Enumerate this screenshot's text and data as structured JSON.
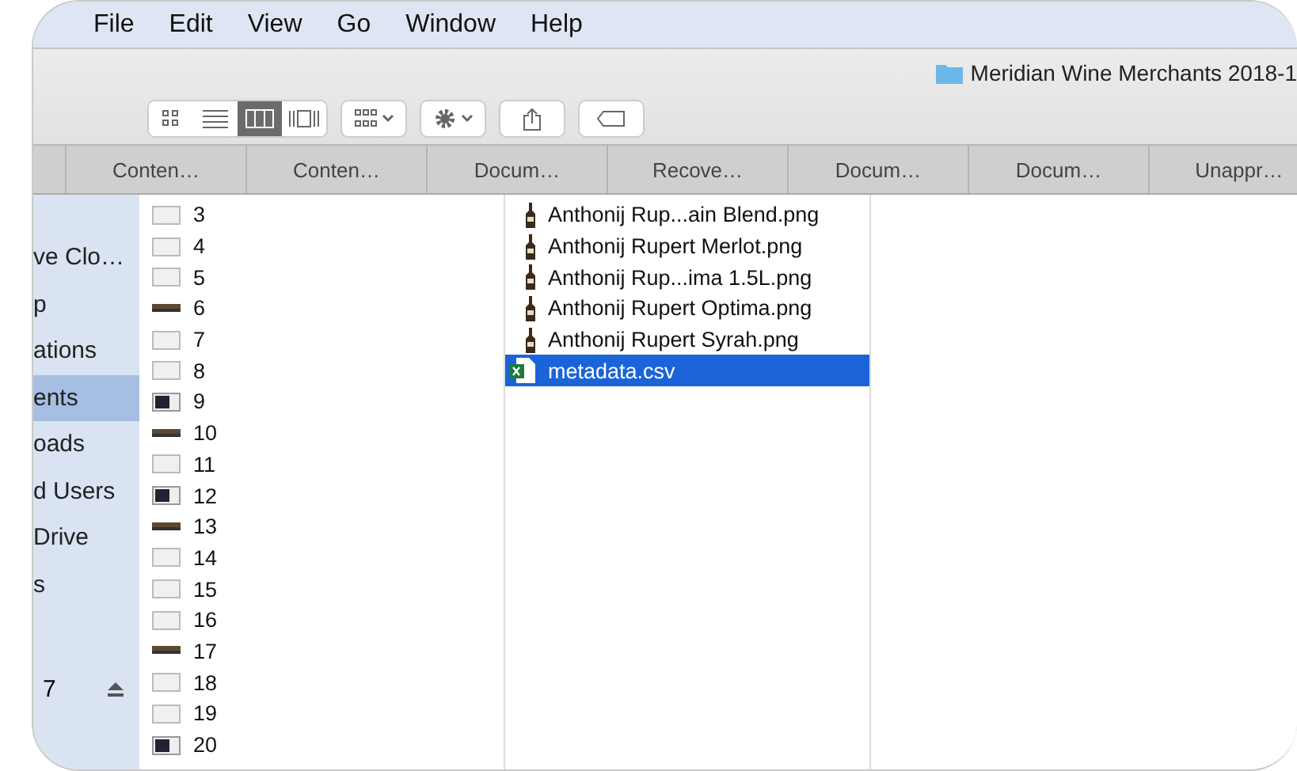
{
  "menu_bar": {
    "items": [
      "File",
      "Edit",
      "View",
      "Go",
      "Window",
      "Help"
    ]
  },
  "window": {
    "title": "Meridian Wine Merchants 2018-1"
  },
  "toolbar": {
    "view_buttons": [
      {
        "kind": "icons",
        "selected": false
      },
      {
        "kind": "list",
        "selected": false
      },
      {
        "kind": "columns",
        "selected": true
      },
      {
        "kind": "coverflow",
        "selected": false
      }
    ]
  },
  "tabs": [
    {
      "label": "Conten…",
      "selected": false
    },
    {
      "label": "Conten…",
      "selected": false
    },
    {
      "label": "Docum…",
      "selected": false
    },
    {
      "label": "Recove…",
      "selected": false
    },
    {
      "label": "Docum…",
      "selected": false
    },
    {
      "label": "Docum…",
      "selected": false
    },
    {
      "label": "Unappr…",
      "selected": false
    }
  ],
  "sidebar": {
    "items": [
      {
        "label": "ve Clo…",
        "selected": false
      },
      {
        "label": "p",
        "selected": false
      },
      {
        "label": "ations",
        "selected": false
      },
      {
        "label": "ents",
        "selected": true
      },
      {
        "label": "oads",
        "selected": false
      },
      {
        "label": "d Users",
        "selected": false
      },
      {
        "label": "Drive",
        "selected": false
      },
      {
        "label": "s",
        "selected": false
      }
    ],
    "device": {
      "label": "7"
    }
  },
  "column_1": [
    {
      "name": "3",
      "kind": "light",
      "selected": false
    },
    {
      "name": "4",
      "kind": "light",
      "selected": false
    },
    {
      "name": "5",
      "kind": "light",
      "selected": false
    },
    {
      "name": "6",
      "kind": "dark",
      "selected": false
    },
    {
      "name": "7",
      "kind": "light",
      "selected": false
    },
    {
      "name": "8",
      "kind": "light",
      "selected": false
    },
    {
      "name": "9",
      "kind": "screen",
      "selected": false
    },
    {
      "name": "10",
      "kind": "dark",
      "selected": false
    },
    {
      "name": "11",
      "kind": "light",
      "selected": false
    },
    {
      "name": "12",
      "kind": "screen",
      "selected": false
    },
    {
      "name": "13",
      "kind": "dark",
      "selected": false
    },
    {
      "name": "14",
      "kind": "light",
      "selected": false
    },
    {
      "name": "15",
      "kind": "light",
      "selected": false
    },
    {
      "name": "16",
      "kind": "light",
      "selected": false
    },
    {
      "name": "17",
      "kind": "dark",
      "selected": false
    },
    {
      "name": "18",
      "kind": "light",
      "selected": false
    },
    {
      "name": "19",
      "kind": "light",
      "selected": false
    },
    {
      "name": "20",
      "kind": "screen",
      "selected": false
    }
  ],
  "column_2": [
    {
      "name": "Anthonij Rup...ain Blend.png",
      "kind": "bottle",
      "selected": false
    },
    {
      "name": "Anthonij Rupert Merlot.png",
      "kind": "bottle",
      "selected": false
    },
    {
      "name": "Anthonij Rup...ima 1.5L.png",
      "kind": "bottle",
      "selected": false
    },
    {
      "name": "Anthonij Rupert Optima.png",
      "kind": "bottle",
      "selected": false
    },
    {
      "name": "Anthonij Rupert Syrah.png",
      "kind": "bottle",
      "selected": false
    },
    {
      "name": "metadata.csv",
      "kind": "spreadsheet",
      "selected": true
    }
  ]
}
